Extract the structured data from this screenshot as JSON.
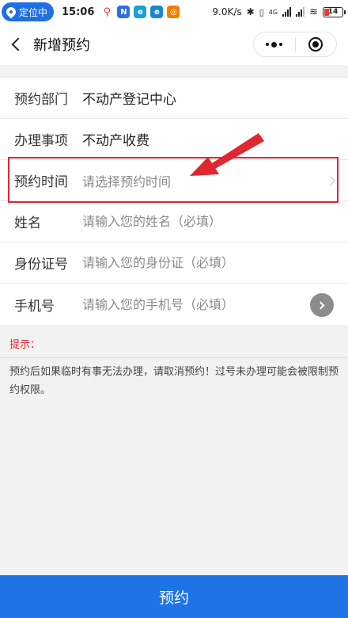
{
  "status_bar": {
    "location_label": "定位中",
    "time": "15:06",
    "network_speed": "9.0K/s",
    "network_type": "4G",
    "battery_level": "14",
    "app_icons": [
      {
        "name": "maps-pin-icon",
        "color": "#e53935",
        "glyph": "⚲"
      },
      {
        "name": "app-n-icon",
        "color": "#2e6fe0",
        "glyph": "N"
      },
      {
        "name": "app-e-icon-1",
        "color": "#1aa0d8",
        "glyph": "e"
      },
      {
        "name": "app-e-icon-2",
        "color": "#1a86d8",
        "glyph": "e"
      },
      {
        "name": "app-orange-icon",
        "color": "#f57c00",
        "glyph": "◎"
      }
    ]
  },
  "nav": {
    "title": "新增预约"
  },
  "form": {
    "rows": [
      {
        "label": "预约部门",
        "value": "不动产登记中心"
      },
      {
        "label": "办理事项",
        "value": "不动产收费"
      },
      {
        "label": "预约时间",
        "placeholder": "请选择预约时间"
      },
      {
        "label": "姓名",
        "placeholder": "请输入您的姓名（必填）"
      },
      {
        "label": "身份证号",
        "placeholder": "请输入您的身份证（必填）"
      },
      {
        "label": "手机号",
        "placeholder": "请输入您的手机号（必填）"
      }
    ]
  },
  "tips": {
    "title": "提示：",
    "text": "预约后如果临时有事无法办理，请取消预约！过号未办理可能会被限制预约权限。"
  },
  "submit": {
    "label": "预约"
  },
  "colors": {
    "accent": "#1e73e6",
    "annotation": "#e0262e",
    "tips_title": "#e0262e"
  }
}
